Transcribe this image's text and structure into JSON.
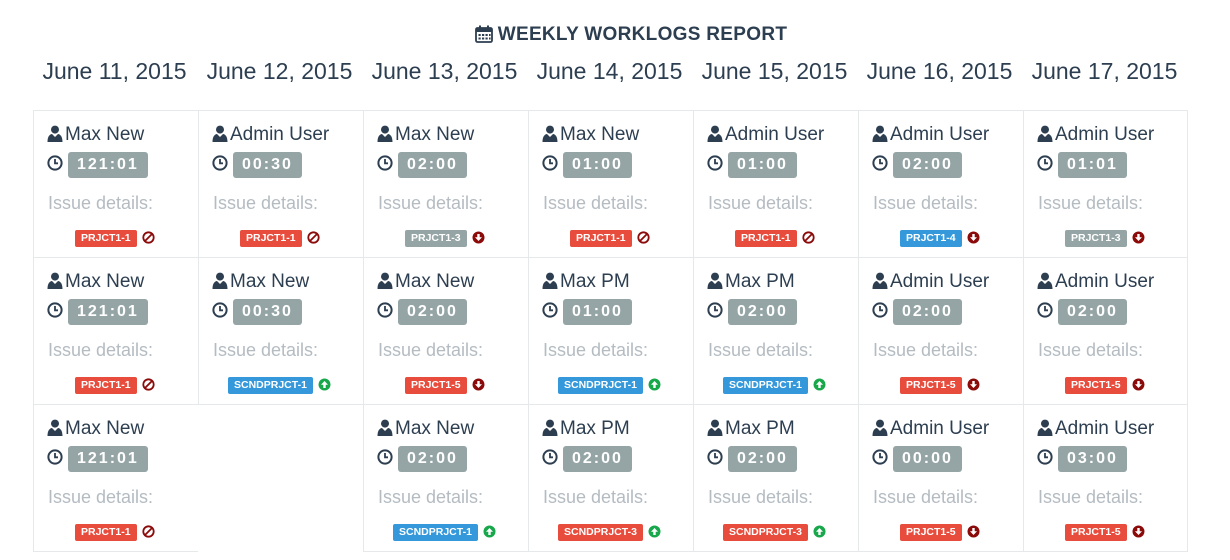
{
  "header": {
    "title": "WEEKLY WORKLOGS REPORT",
    "icon": "calendar-icon"
  },
  "dates": [
    "June 11, 2015",
    "June 12, 2015",
    "June 13, 2015",
    "June 14, 2015",
    "June 15, 2015",
    "June 16, 2015",
    "June 17, 2015"
  ],
  "issue_label": "Issue details:",
  "colors": {
    "red": "#e74c3c",
    "blue": "#3498db",
    "gray": "#95a5a6",
    "up_green": "#18a84b",
    "down_red": "#8b0a0a",
    "ban_red": "#8b0a0a"
  },
  "worklogs": [
    [
      {
        "user": "Max New",
        "time": "121:01",
        "issue": "PRJCT1-1",
        "color": "red",
        "status": "ban-icon"
      },
      {
        "user": "Max New",
        "time": "121:01",
        "issue": "PRJCT1-1",
        "color": "red",
        "status": "ban-icon"
      },
      {
        "user": "Max New",
        "time": "121:01",
        "issue": "PRJCT1-1",
        "color": "red",
        "status": "ban-icon"
      }
    ],
    [
      {
        "user": "Admin User",
        "time": "00:30",
        "issue": "PRJCT1-1",
        "color": "red",
        "status": "ban-icon"
      },
      {
        "user": "Max New",
        "time": "00:30",
        "issue": "SCNDPRJCT-1",
        "color": "blue",
        "status": "arrow-up-icon"
      }
    ],
    [
      {
        "user": "Max New",
        "time": "02:00",
        "issue": "PRJCT1-3",
        "color": "gray",
        "status": "arrow-down-icon"
      },
      {
        "user": "Max New",
        "time": "02:00",
        "issue": "PRJCT1-5",
        "color": "red",
        "status": "arrow-down-icon"
      },
      {
        "user": "Max New",
        "time": "02:00",
        "issue": "SCNDPRJCT-1",
        "color": "blue",
        "status": "arrow-up-icon"
      }
    ],
    [
      {
        "user": "Max New",
        "time": "01:00",
        "issue": "PRJCT1-1",
        "color": "red",
        "status": "ban-icon"
      },
      {
        "user": "Max PM",
        "time": "01:00",
        "issue": "SCNDPRJCT-1",
        "color": "blue",
        "status": "arrow-up-icon"
      },
      {
        "user": "Max PM",
        "time": "02:00",
        "issue": "SCNDPRJCT-3",
        "color": "red",
        "status": "arrow-up-icon"
      }
    ],
    [
      {
        "user": "Admin User",
        "time": "01:00",
        "issue": "PRJCT1-1",
        "color": "red",
        "status": "ban-icon"
      },
      {
        "user": "Max PM",
        "time": "02:00",
        "issue": "SCNDPRJCT-1",
        "color": "blue",
        "status": "arrow-up-icon"
      },
      {
        "user": "Max PM",
        "time": "02:00",
        "issue": "SCNDPRJCT-3",
        "color": "red",
        "status": "arrow-up-icon"
      }
    ],
    [
      {
        "user": "Admin User",
        "time": "02:00",
        "issue": "PRJCT1-4",
        "color": "blue",
        "status": "arrow-down-icon"
      },
      {
        "user": "Admin User",
        "time": "02:00",
        "issue": "PRJCT1-5",
        "color": "red",
        "status": "arrow-down-icon"
      },
      {
        "user": "Admin User",
        "time": "00:00",
        "issue": "PRJCT1-5",
        "color": "red",
        "status": "arrow-down-icon"
      }
    ],
    [
      {
        "user": "Admin User",
        "time": "01:01",
        "issue": "PRJCT1-3",
        "color": "gray",
        "status": "arrow-down-icon"
      },
      {
        "user": "Admin User",
        "time": "02:00",
        "issue": "PRJCT1-5",
        "color": "red",
        "status": "arrow-down-icon"
      },
      {
        "user": "Admin User",
        "time": "03:00",
        "issue": "PRJCT1-5",
        "color": "red",
        "status": "arrow-down-icon"
      }
    ]
  ]
}
